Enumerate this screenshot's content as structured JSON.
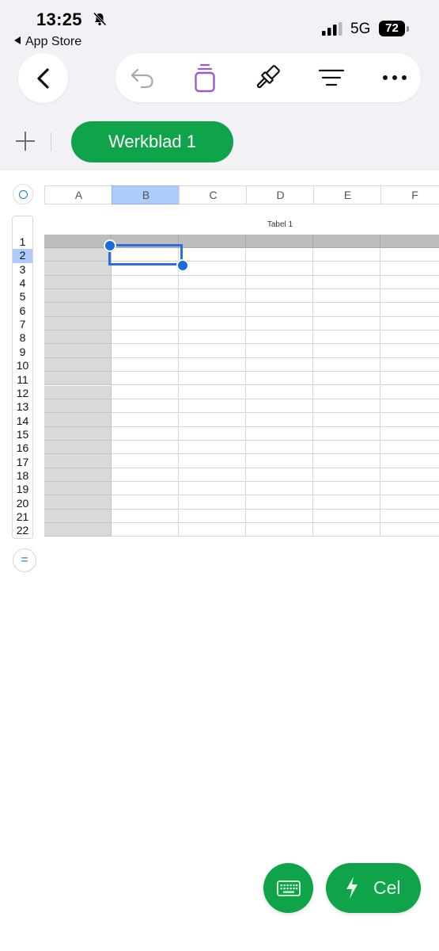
{
  "status_bar": {
    "time": "13:25",
    "back_app": "App Store",
    "network": "5G",
    "battery": "72"
  },
  "toolbar": {
    "icons": [
      "back-icon",
      "undo-icon",
      "insert-icon",
      "format-brush-icon",
      "organize-icon",
      "more-icon"
    ]
  },
  "sheet_tabs": {
    "active": "Werkblad 1"
  },
  "table": {
    "title": "Tabel 1",
    "columns": [
      "A",
      "B",
      "C",
      "D",
      "E",
      "F"
    ],
    "rows": [
      "1",
      "2",
      "3",
      "4",
      "5",
      "6",
      "7",
      "8",
      "9",
      "10",
      "11",
      "12",
      "13",
      "14",
      "15",
      "16",
      "17",
      "18",
      "19",
      "20",
      "21",
      "22"
    ],
    "selected_cell": "B2"
  },
  "bottom_actions": {
    "keyboard_icon": "keyboard-icon",
    "cell_label": "Cel"
  },
  "colors": {
    "accent_green": "#0fa34a",
    "selection_blue": "#2a6fdb",
    "column_highlight": "#aecbfa",
    "toolbar_insert": "#9b59d0"
  }
}
